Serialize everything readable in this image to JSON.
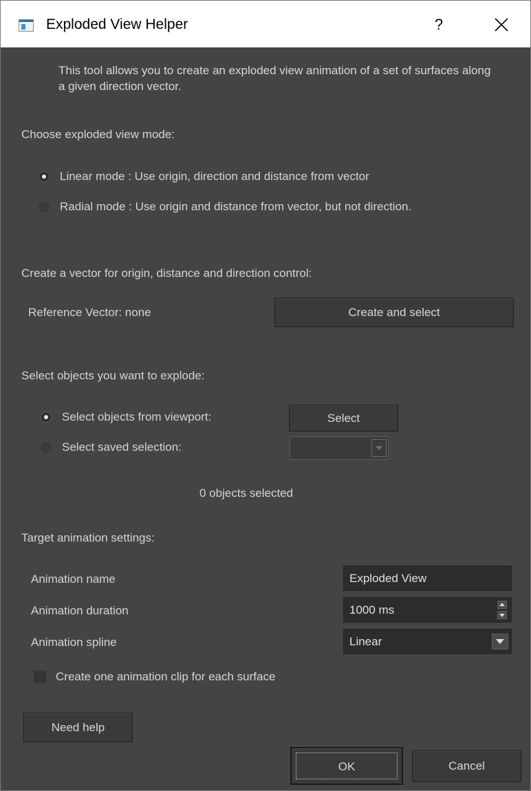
{
  "window": {
    "title": "Exploded View Helper",
    "help_label": "?",
    "close_icon": "close-icon"
  },
  "intro": "This tool allows you to create an exploded view animation of a set of surfaces along a given direction vector.",
  "mode": {
    "heading": "Choose exploded view mode:",
    "options": [
      {
        "label": "Linear mode : Use origin, direction and distance from vector",
        "checked": true
      },
      {
        "label": "Radial mode : Use origin and distance from vector, but not direction.",
        "checked": false
      }
    ]
  },
  "vector": {
    "heading": "Create a vector for origin, distance and direction control:",
    "reference_label": "Reference Vector: none",
    "create_button": "Create and select"
  },
  "selection": {
    "heading": "Select objects you want to explode:",
    "options": [
      {
        "label": "Select objects from viewport:",
        "checked": true
      },
      {
        "label": "Select saved selection:",
        "checked": false
      }
    ],
    "select_button": "Select",
    "saved_selection_value": "",
    "count_text": "0 objects selected"
  },
  "animation": {
    "heading": "Target animation settings:",
    "name_label": "Animation name",
    "name_value": "Exploded View",
    "duration_label": "Animation duration",
    "duration_value": "1000 ms",
    "spline_label": "Animation spline",
    "spline_value": "Linear",
    "per_surface_label": "Create one animation clip for each surface",
    "per_surface_checked": false
  },
  "footer": {
    "help_button": "Need help",
    "ok_button": "OK",
    "cancel_button": "Cancel"
  },
  "colors": {
    "background": "#444444",
    "text": "#d4d4d4",
    "field": "#2c2c2c",
    "title_bar": "#ffffff"
  }
}
